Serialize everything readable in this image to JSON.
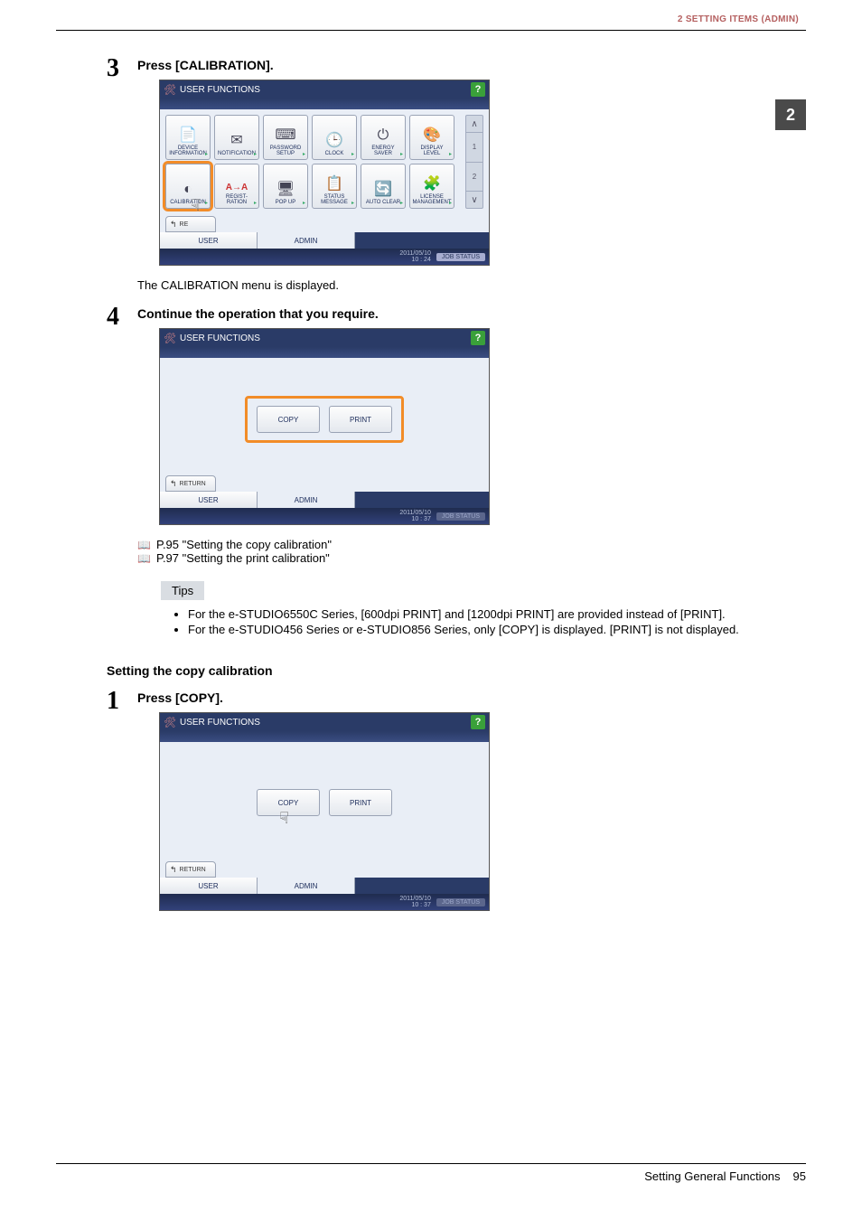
{
  "header": {
    "breadcrumb": "2 SETTING ITEMS (ADMIN)"
  },
  "side_tab": "2",
  "steps": {
    "s3": {
      "num": "3",
      "title": "Press [CALIBRATION].",
      "note": "The CALIBRATION menu is displayed."
    },
    "s4": {
      "num": "4",
      "title": "Continue the operation that you require."
    },
    "sub": {
      "heading": "Setting the copy calibration",
      "s1": {
        "num": "1",
        "title": "Press [COPY]."
      }
    }
  },
  "refs": {
    "r1": "P.95 \"Setting the copy calibration\"",
    "r2": "P.97 \"Setting the print calibration\""
  },
  "tips": {
    "label": "Tips",
    "items": [
      "For the e-STUDIO6550C Series, [600dpi PRINT] and [1200dpi PRINT] are provided instead of [PRINT].",
      "For the e-STUDIO456 Series or e-STUDIO856 Series, only [COPY] is displayed. [PRINT] is not displayed."
    ]
  },
  "screenshot_common": {
    "title": "USER FUNCTIONS",
    "help": "?",
    "tab_user": "USER",
    "tab_admin": "ADMIN",
    "return": "RE",
    "return_full": "RETURN",
    "job_status": "JOB STATUS",
    "scroll_top": "∧",
    "scroll_bottom": "∨",
    "page1": "1",
    "page2": "2"
  },
  "screenshot1": {
    "date1": "2011/05/10",
    "time1": "10 : 24",
    "row1": [
      {
        "label": "DEVICE\nINFORMATION"
      },
      {
        "label": "NOTIFICATION"
      },
      {
        "label": "PASSWORD\nSETUP"
      },
      {
        "label": "CLOCK"
      },
      {
        "label": "ENERGY\nSAVER"
      },
      {
        "label": "DISPLAY\nLEVEL"
      }
    ],
    "row2": [
      {
        "label": "CALIBRATION",
        "highlight": true
      },
      {
        "label": "REGIST-\nRATION",
        "sup": "A→A"
      },
      {
        "label": "POP UP"
      },
      {
        "label": "STATUS\nMESSAGE"
      },
      {
        "label": "AUTO CLEAR"
      },
      {
        "label": "LICENSE\nMANAGEMENT"
      }
    ]
  },
  "screenshot2": {
    "date": "2011/05/10",
    "time": "10 : 37",
    "copy": "COPY",
    "print": "PRINT"
  },
  "screenshot3": {
    "date": "2011/05/10",
    "time": "10 : 37",
    "copy": "COPY",
    "print": "PRINT"
  },
  "footer": {
    "section": "Setting General Functions",
    "page": "95"
  }
}
